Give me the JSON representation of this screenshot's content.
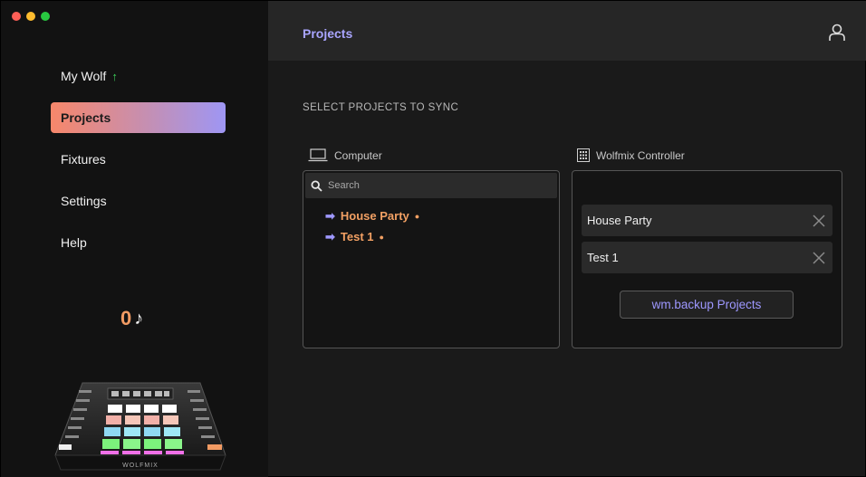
{
  "sidebar": {
    "items": [
      {
        "label": "My Wolf",
        "badge": "↑"
      },
      {
        "label": "Projects"
      },
      {
        "label": "Fixtures"
      },
      {
        "label": "Settings"
      },
      {
        "label": "Help"
      }
    ],
    "counter": {
      "value": "0",
      "symbol": "♪"
    },
    "device_brand": "WOLFMIX"
  },
  "header": {
    "title": "Projects"
  },
  "main": {
    "section_title": "SELECT PROJECTS TO SYNC",
    "computer": {
      "label": "Computer",
      "search_placeholder": "Search",
      "projects": [
        "House Party",
        "Test 1"
      ]
    },
    "controller": {
      "label": "Wolfmix Controller",
      "projects": [
        "House Party",
        "Test 1"
      ],
      "backup_label": "wm.backup Projects"
    }
  },
  "colors": {
    "accent_purple": "#9e98ff",
    "accent_orange": "#f2a063",
    "active_gradient_start": "#f7876a",
    "active_gradient_end": "#9e96f4"
  }
}
